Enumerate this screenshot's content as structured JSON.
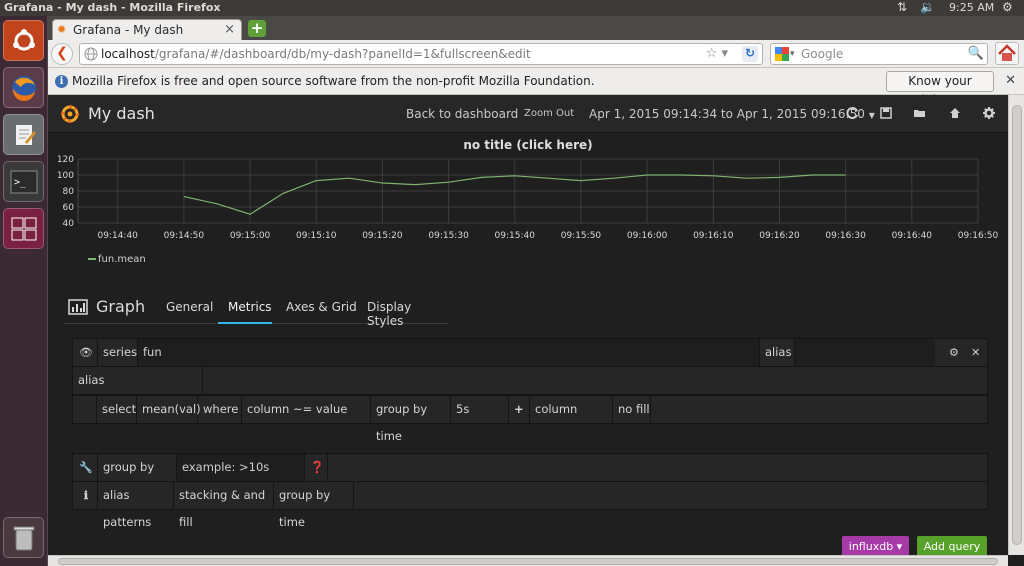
{
  "os": {
    "window_title": "Grafana - My dash - Mozilla Firefox",
    "clock": "9:25 AM"
  },
  "browser": {
    "tab_title": "Grafana - My dash",
    "url_host": "localhost",
    "url_path": "/grafana/#/dashboard/db/my-dash?panelId=1&fullscreen&edit",
    "search_placeholder": "Google",
    "notification": "Mozilla Firefox is free and open source software from the non-profit Mozilla Foundation.",
    "know_rights": "Know your rights…"
  },
  "grafana": {
    "dashboard_title": "My dash",
    "back_link": "Back to dashboard",
    "zoom_out": "Zoom Out",
    "time_range": "Apr 1, 2015 09:14:34 to Apr 1, 2015 09:16:50",
    "panel_title": "no title (click here)",
    "legend_series": "fun.mean",
    "editor": {
      "title": "Graph",
      "tabs": [
        "General",
        "Metrics",
        "Axes & Grid",
        "Display Styles"
      ],
      "active_tab": "Metrics"
    },
    "query": {
      "series_label": "series",
      "series_value": "fun",
      "alias_label": "alias",
      "alias_row_label": "alias",
      "select_label": "select",
      "select_value": "mean(val)",
      "where_label": "where",
      "where_value": "column ~= value",
      "group_by_time_label": "group by time",
      "group_by_time_value": "5s",
      "column_label": "column",
      "fill_label": "no fill"
    },
    "options": {
      "group_by_time_label": "group by time",
      "group_by_time_placeholder": "example: >10s",
      "help_items": [
        "alias patterns",
        "stacking & and fill",
        "group by time"
      ]
    },
    "buttons": {
      "datasource": "influxdb ▾",
      "add_query": "Add query"
    }
  },
  "chart_data": {
    "type": "line",
    "title": "no title (click here)",
    "x_ticks": [
      "09:14:40",
      "09:14:50",
      "09:15:00",
      "09:15:10",
      "09:15:20",
      "09:15:30",
      "09:15:40",
      "09:15:50",
      "09:16:00",
      "09:16:10",
      "09:16:20",
      "09:16:30",
      "09:16:40",
      "09:16:50"
    ],
    "y_ticks": [
      40,
      60,
      80,
      100,
      120
    ],
    "ylim": [
      40,
      120
    ],
    "x_start_seconds": 34,
    "x_end_seconds": 170,
    "series": [
      {
        "name": "fun.mean",
        "color": "#7eb26d",
        "x": [
          "09:14:50",
          "09:14:55",
          "09:15:00",
          "09:15:05",
          "09:15:10",
          "09:15:15",
          "09:15:20",
          "09:15:25",
          "09:15:30",
          "09:15:35",
          "09:15:40",
          "09:15:45",
          "09:15:50",
          "09:15:55",
          "09:16:00",
          "09:16:05",
          "09:16:10",
          "09:16:15",
          "09:16:20",
          "09:16:25",
          "09:16:30"
        ],
        "values": [
          73,
          64,
          51,
          77,
          93,
          96,
          90,
          88,
          91,
          97,
          99,
          96,
          93,
          96,
          100,
          100,
          99,
          96,
          97,
          100,
          100
        ]
      }
    ]
  }
}
